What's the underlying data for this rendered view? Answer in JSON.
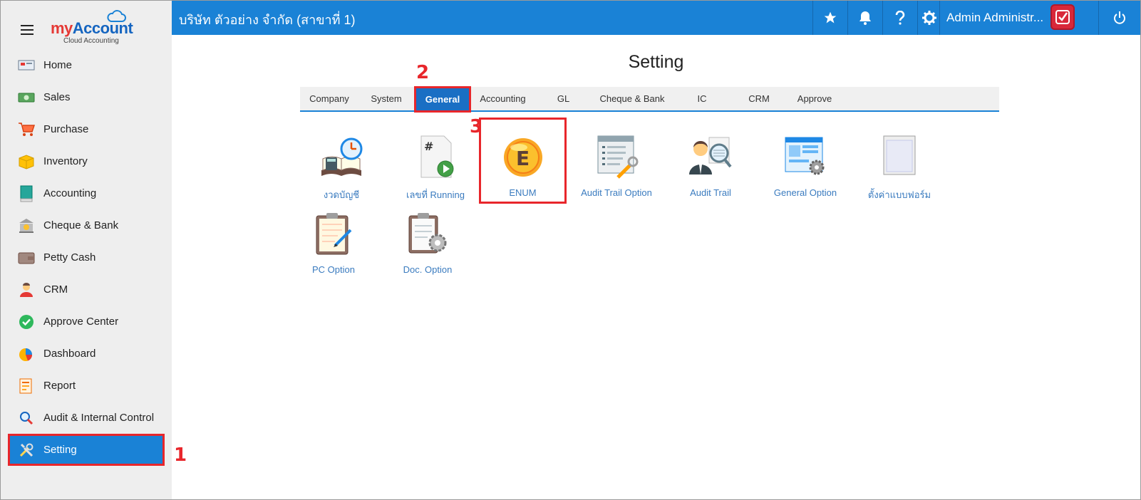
{
  "sidebar": {
    "logo": {
      "my": "my",
      "account": "Account",
      "sub": "Cloud Accounting"
    },
    "items": [
      {
        "label": "Home",
        "icon": "home-icon"
      },
      {
        "label": "Sales",
        "icon": "money-icon"
      },
      {
        "label": "Purchase",
        "icon": "cart-icon"
      },
      {
        "label": "Inventory",
        "icon": "box-icon"
      },
      {
        "label": "Accounting",
        "icon": "book-icon"
      },
      {
        "label": "Cheque & Bank",
        "icon": "bank-icon"
      },
      {
        "label": "Petty Cash",
        "icon": "wallet-icon"
      },
      {
        "label": "CRM",
        "icon": "people-icon"
      },
      {
        "label": "Approve Center",
        "icon": "check-circle-icon"
      },
      {
        "label": "Dashboard",
        "icon": "pie-chart-icon"
      },
      {
        "label": "Report",
        "icon": "report-icon"
      },
      {
        "label": "Audit & Internal Control",
        "icon": "magnifier-icon"
      },
      {
        "label": "Setting",
        "icon": "tools-icon",
        "active": true
      }
    ]
  },
  "topbar": {
    "company": "บริษัท ตัวอย่าง จำกัด (สาขาที่ 1)",
    "user": "Admin Administr..."
  },
  "main": {
    "title": "Setting",
    "tabs": [
      {
        "label": "Company"
      },
      {
        "label": "System"
      },
      {
        "label": "General",
        "active": true
      },
      {
        "label": "Accounting"
      },
      {
        "label": "GL"
      },
      {
        "label": "Cheque & Bank"
      },
      {
        "label": "IC"
      },
      {
        "label": "CRM"
      },
      {
        "label": "Approve"
      }
    ],
    "tiles": [
      {
        "label": "งวดบัญชี",
        "icon": "calendar-book-icon"
      },
      {
        "label": "เลขที่ Running",
        "icon": "running-number-icon"
      },
      {
        "label": "ENUM",
        "icon": "enum-coin-icon"
      },
      {
        "label": "Audit Trail Option",
        "icon": "audit-trail-option-icon"
      },
      {
        "label": "Audit Trail",
        "icon": "audit-trail-icon"
      },
      {
        "label": "General Option",
        "icon": "general-option-icon"
      },
      {
        "label": "ตั้งค่าแบบฟอร์ม",
        "icon": "form-setting-icon"
      },
      {
        "label": "PC Option",
        "icon": "pc-option-icon"
      },
      {
        "label": "Doc. Option",
        "icon": "doc-option-icon"
      }
    ]
  },
  "annotations": {
    "step1": "1",
    "step2": "2",
    "step3": "3"
  },
  "colors": {
    "accent": "#1a82d6",
    "highlight": "#e8262b",
    "link": "#3a7bbf"
  }
}
